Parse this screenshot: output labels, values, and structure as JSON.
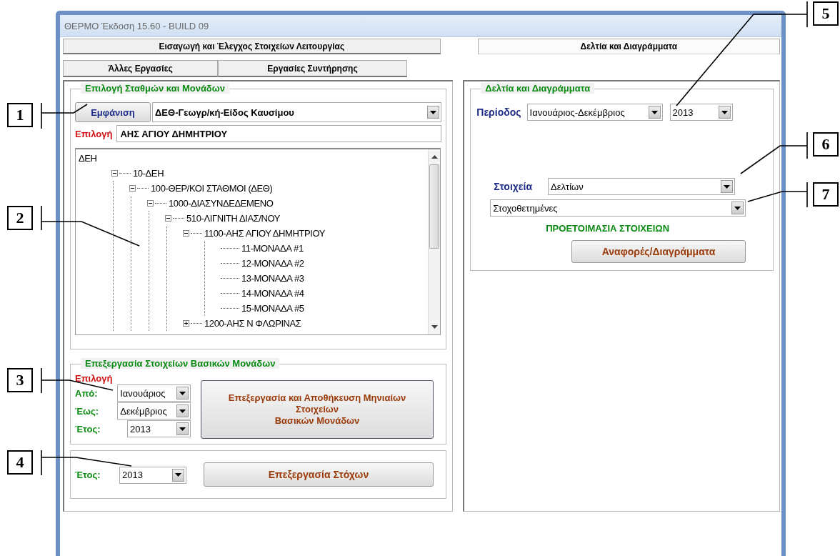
{
  "window": {
    "title": "ΘΕΡΜΟ Έκδοση 15.60 -  BUILD 09"
  },
  "tabs_top": [
    {
      "label": "Εισαγωγή και Έλεγχος Στοιχείων Λειτουργίας",
      "selected": false
    },
    {
      "label": "Δελτία και Διαγράμματα",
      "selected": true
    }
  ],
  "tabs_second": [
    {
      "label": "Άλλες Εργασίες",
      "selected": false
    },
    {
      "label": "Εργασίες Συντήρησης",
      "selected": false
    }
  ],
  "stations": {
    "title": "Επιλογή Σταθμών και Μονάδων",
    "show_button": "Εμφάνιση",
    "grouping": "ΔΕΘ-Γεωγρ/κή-Είδος Καυσίμου",
    "selection_label": "Επιλογή",
    "selection_value": "ΑΗΣ ΑΓΙΟΥ ΔΗΜΗΤΡΙΟΥ",
    "tree": [
      {
        "label": "ΔΕΗ",
        "children": [
          {
            "label": "10-ΔΕΗ",
            "expanded": true,
            "children": [
              {
                "label": "100-ΘΕΡ/ΚΟΙ ΣΤΑΘΜΟΙ (ΔΕΘ)",
                "expanded": true,
                "children": [
                  {
                    "label": "1000-ΔΙΑΣΥΝΔΕΔΕΜΕΝΟ",
                    "expanded": true,
                    "children": [
                      {
                        "label": "510-ΛΙΓΝΙΤΗ ΔΙΑΣ/ΝΟΥ",
                        "expanded": true,
                        "children": [
                          {
                            "label": "1100-ΑΗΣ ΑΓΙΟΥ ΔΗΜΗΤΡΙΟΥ",
                            "expanded": true,
                            "children": [
                              {
                                "label": "11-ΜΟΝΑΔΑ #1"
                              },
                              {
                                "label": "12-ΜΟΝΑΔΑ #2"
                              },
                              {
                                "label": "13-ΜΟΝΑΔΑ #3"
                              },
                              {
                                "label": "14-ΜΟΝΑΔΑ #4"
                              },
                              {
                                "label": "15-ΜΟΝΑΔΑ #5"
                              }
                            ]
                          },
                          {
                            "label": "1200-ΑΗΣ Ν ΦΛΩΡΙΝΑΣ",
                            "expanded": false
                          }
                        ]
                      }
                    ]
                  }
                ]
              }
            ]
          }
        ]
      }
    ]
  },
  "processing": {
    "title": "Επεξεργασία Στοιχείων Βασικών Μονάδων",
    "selection_label": "Επιλογή",
    "fields": [
      {
        "label": "Από:",
        "value": "Ιανουάριος"
      },
      {
        "label": "Έως:",
        "value": "Δεκέμβριος"
      },
      {
        "label": "Έτος:",
        "value": "2013"
      }
    ],
    "button_lines": [
      "Επεξεργασία  και Αποθήκευση Μηνιαίων",
      "Στοιχείων",
      "Βασικών Μονάδων"
    ]
  },
  "targets": {
    "year_label": "Έτος:",
    "year": "2013",
    "button": "Επεξεργασία Στόχων"
  },
  "reports": {
    "title": "Δελτία και Διαγράμματα",
    "period_label": "Περίοδος",
    "period": "Ιανουάριος-Δεκέμβριος",
    "year": "2013",
    "data_label": "Στοιχεία",
    "data": "Δελτίων",
    "kind_value": "Στοχοθετημένες",
    "status": "ΠΡΟΕΤΟΙΜΑΣΙΑ ΣΤΟΙΧΕΙΩΝ",
    "button": "Αναφορές/Διαγράμματα"
  },
  "callouts": [
    "1",
    "2",
    "3",
    "4",
    "5",
    "6",
    "7"
  ]
}
